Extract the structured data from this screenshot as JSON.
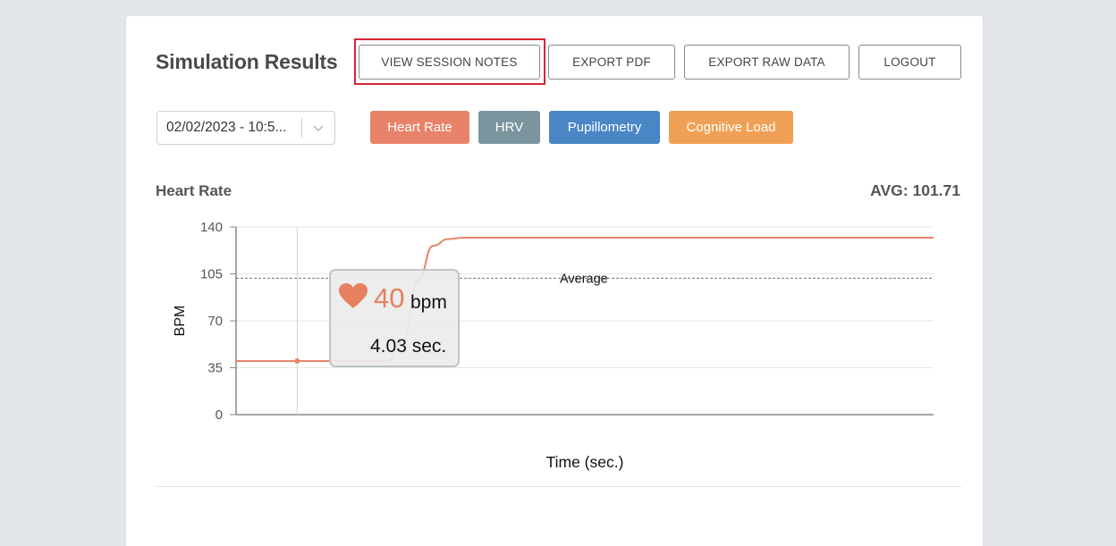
{
  "header": {
    "title": "Simulation Results",
    "buttons": {
      "view_session_notes": "VIEW SESSION NOTES",
      "export_pdf": "EXPORT PDF",
      "export_raw_data": "EXPORT RAW DATA",
      "logout": "LOGOUT"
    }
  },
  "session_select": {
    "value": "02/02/2023 - 10:5..."
  },
  "metrics": {
    "heart_rate": "Heart Rate",
    "hrv": "HRV",
    "pupillometry": "Pupillometry",
    "cognitive_load": "Cognitive Load",
    "colors": {
      "heart_rate": "#e8836a",
      "hrv": "#7b959f",
      "pupillometry": "#4a86c5",
      "cognitive_load": "#f0a056"
    }
  },
  "chart": {
    "title": "Heart Rate",
    "avg_text": "AVG: 101.71",
    "average_label": "Average",
    "tooltip": {
      "icon": "heart-icon",
      "value": "40",
      "unit": "bpm",
      "time": "4.03 sec."
    }
  },
  "chart_data": {
    "type": "line",
    "title": "Heart Rate",
    "xlabel": "Time (sec.)",
    "ylabel": "BPM",
    "ylim": [
      0,
      140
    ],
    "yticks": [
      0,
      35,
      70,
      105,
      140
    ],
    "grid": true,
    "average": 101.71,
    "line_color": "#e8836a",
    "series": [
      {
        "x": [
          0,
          4.03,
          10.0,
          11.0,
          12.0,
          13.0,
          14.0,
          15.0,
          46.0
        ],
        "values": [
          40,
          40,
          40,
          55,
          100,
          126,
          131,
          132,
          132
        ]
      }
    ],
    "hover_point": {
      "x": 4.03,
      "y": 40
    }
  }
}
